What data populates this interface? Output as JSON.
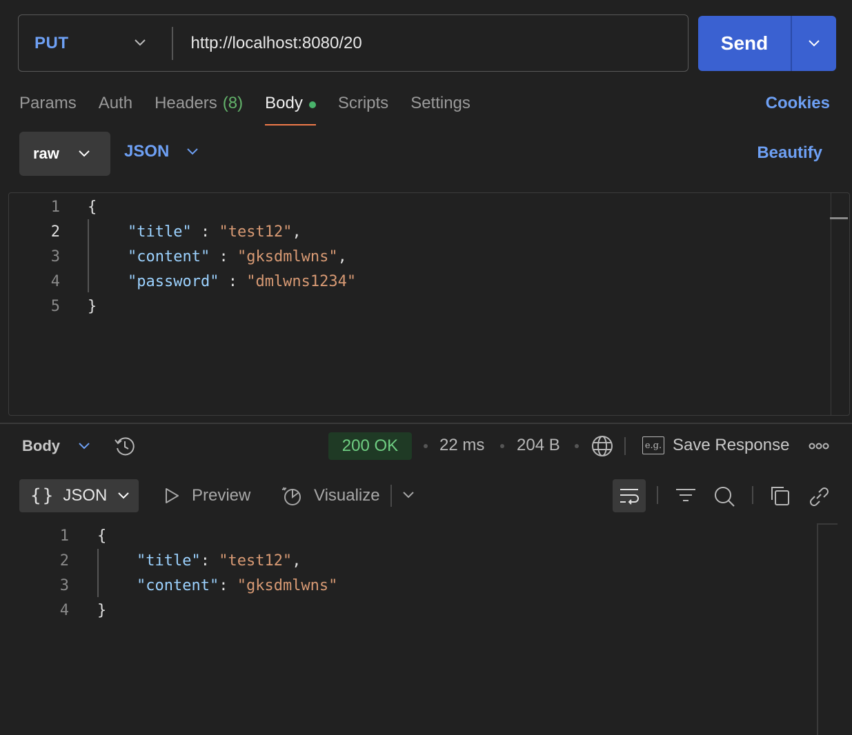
{
  "request": {
    "method": "PUT",
    "url": "http://localhost:8080/20",
    "send_label": "Send"
  },
  "tabs": [
    {
      "label": "Params"
    },
    {
      "label": "Auth"
    },
    {
      "label": "Headers",
      "count": "(8)"
    },
    {
      "label": "Body"
    },
    {
      "label": "Scripts"
    },
    {
      "label": "Settings"
    }
  ],
  "cookies_label": "Cookies",
  "body_mode": {
    "mode": "raw",
    "language": "JSON",
    "beautify_label": "Beautify"
  },
  "request_body": {
    "line_numbers": [
      "1",
      "2",
      "3",
      "4",
      "5"
    ],
    "lines": {
      "open": "{",
      "title_key": "\"title\"",
      "title_val": "\"test12\"",
      "content_key": "\"content\"",
      "content_val": "\"gksdmlwns\"",
      "password_key": "\"password\"",
      "password_val": "\"dmlwns1234\"",
      "close": "}"
    }
  },
  "response": {
    "section_label": "Body",
    "status": "200 OK",
    "time": "22 ms",
    "size": "204 B",
    "save_label": "Save Response",
    "eg_label": "e.g.",
    "format_label": "JSON",
    "preview_label": "Preview",
    "visualize_label": "Visualize",
    "line_numbers": [
      "1",
      "2",
      "3",
      "4"
    ],
    "lines": {
      "open": "{",
      "title_key": "\"title\"",
      "title_val": "\"test12\"",
      "content_key": "\"content\"",
      "content_val": "\"gksdmlwns\"",
      "close": "}"
    }
  },
  "colors": {
    "accent": "#3a61d1",
    "link": "#6ea0f4",
    "status_ok": "#6fce82",
    "json_key": "#9cd2ff",
    "json_string": "#d89a74",
    "tab_underline": "#f07a4a"
  }
}
